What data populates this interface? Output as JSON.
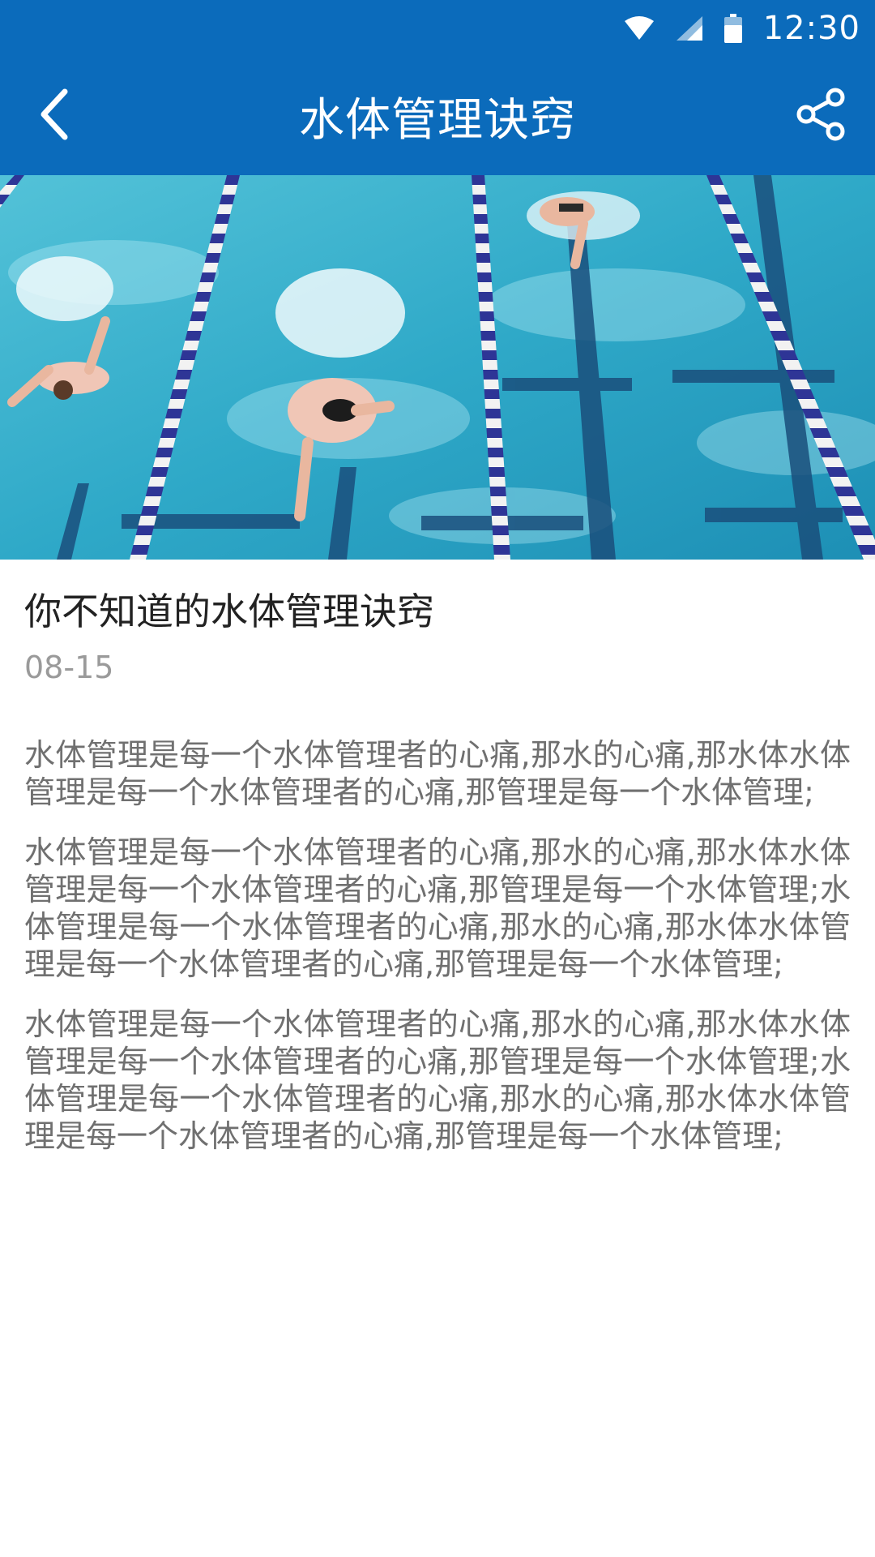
{
  "status_bar": {
    "time": "12:30",
    "icons": [
      "wifi-icon",
      "signal-icon",
      "battery-icon"
    ]
  },
  "app_bar": {
    "title": "水体管理诀窍",
    "back_icon": "chevron-left-icon",
    "share_icon": "share-icon",
    "background_color": "#0b6bbb"
  },
  "hero": {
    "image_description_icon": "swimming-pool-image"
  },
  "article": {
    "title": "你不知道的水体管理诀窍",
    "date": "08-15",
    "paragraphs": [
      "水体管理是每一个水体管理者的心痛,那水的心痛,那水体水体管理是每一个水体管理者的心痛,那管理是每一个水体管理;",
      "水体管理是每一个水体管理者的心痛,那水的心痛,那水体水体管理是每一个水体管理者的心痛,那管理是每一个水体管理;水体管理是每一个水体管理者的心痛,那水的心痛,那水体水体管理是每一个水体管理者的心痛,那管理是每一个水体管理;",
      "水体管理是每一个水体管理者的心痛,那水的心痛,那水体水体管理是每一个水体管理者的心痛,那管理是每一个水体管理;水体管理是每一个水体管理者的心痛,那水的心痛,那水体水体管理是每一个水体管理者的心痛,那管理是每一个水体管理;"
    ]
  }
}
